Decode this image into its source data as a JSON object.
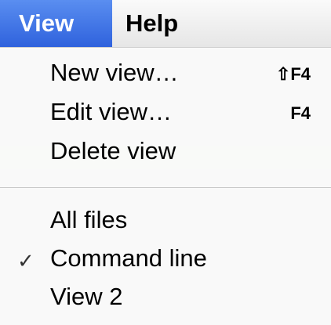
{
  "menubar": {
    "items": [
      {
        "label": "View",
        "active": true
      },
      {
        "label": "Help",
        "active": false
      }
    ]
  },
  "view_menu": {
    "items": [
      {
        "label": "New view…",
        "shortcut": "⇧F4"
      },
      {
        "label": "Edit view…",
        "shortcut": "F4"
      },
      {
        "label": "Delete view",
        "shortcut": ""
      },
      {
        "label": "All files",
        "shortcut": ""
      },
      {
        "label": "Command line",
        "shortcut": "",
        "checked": true,
        "check_glyph": "✓"
      },
      {
        "label": "View 2",
        "shortcut": ""
      }
    ]
  },
  "colors": {
    "highlight": "#2f62dd",
    "menu_background": "#fafafa"
  }
}
